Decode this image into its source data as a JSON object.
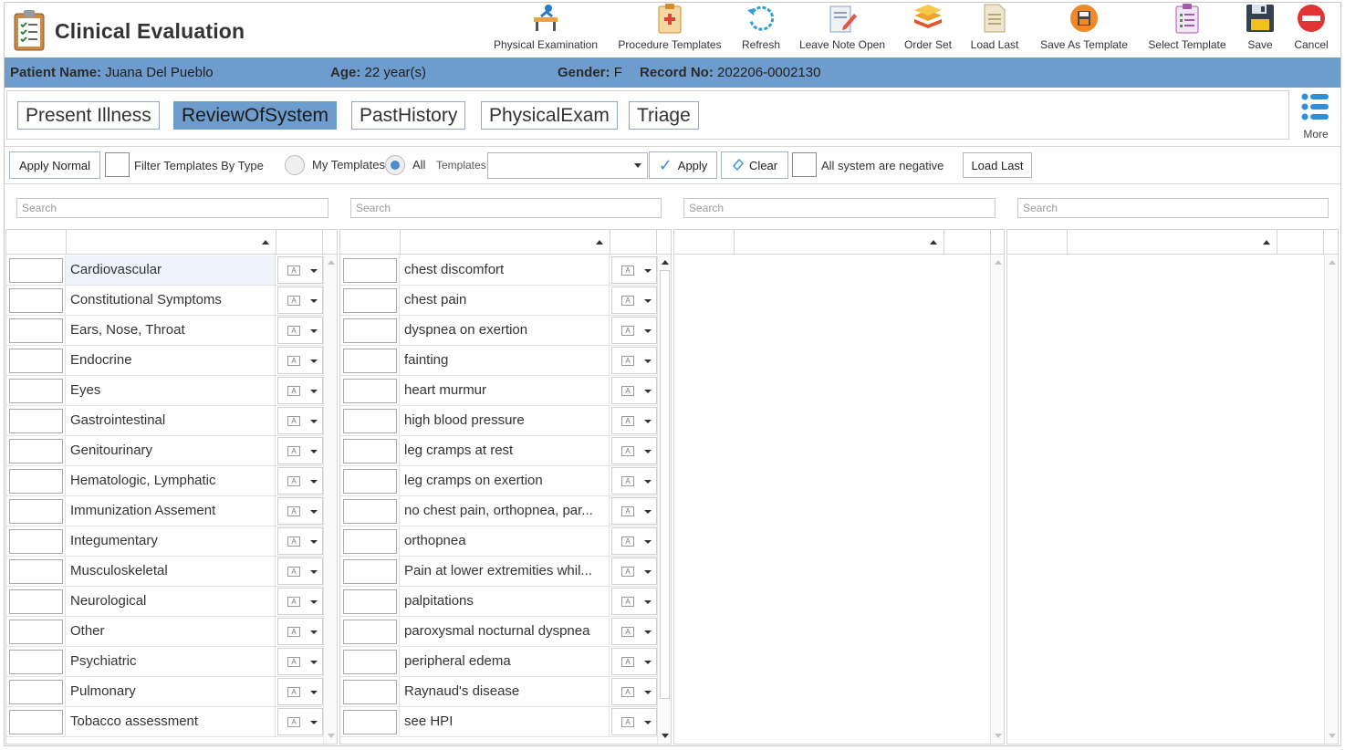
{
  "app": {
    "title": "Clinical Evaluation"
  },
  "toolbar": [
    {
      "label": "Physical Examination",
      "icon": "exam-table-icon"
    },
    {
      "label": "Procedure Templates",
      "icon": "clipboard-medical-icon"
    },
    {
      "label": "Refresh",
      "icon": "refresh-icon"
    },
    {
      "label": "Leave Note Open",
      "icon": "note-edit-icon"
    },
    {
      "label": "Order Set",
      "icon": "layers-icon"
    },
    {
      "label": "Load Last",
      "icon": "document-icon"
    },
    {
      "label": "Save As Template",
      "icon": "save-as-icon"
    },
    {
      "label": "Select Template",
      "icon": "template-list-icon"
    },
    {
      "label": "Save",
      "icon": "floppy-disk-icon"
    },
    {
      "label": "Cancel",
      "icon": "cancel-icon"
    }
  ],
  "patient": {
    "name_label": "Patient Name:",
    "name": "Juana Del Pueblo",
    "age_label": "Age:",
    "age": "22 year(s)",
    "gender_label": "Gender:",
    "gender": "F",
    "record_label": "Record No:",
    "record": "202206-0002130"
  },
  "tabs": [
    "Present Illness",
    "ReviewOfSystem",
    "PastHistory",
    "PhysicalExam",
    "Triage"
  ],
  "active_tab": "ReviewOfSystem",
  "more_label": "More",
  "filters": {
    "apply_normal": "Apply Normal",
    "filter_by_type": "Filter Templates By Type",
    "my_templates": "My Templates",
    "all": "All",
    "templates_label": "Templates:",
    "templates_value": "",
    "apply": "Apply",
    "clear": "Clear",
    "all_negative": "All system are negative",
    "load_last": "Load Last"
  },
  "search_placeholder": "Search",
  "systems": [
    "Cardiovascular",
    "Constitutional Symptoms",
    "Ears, Nose, Throat",
    "Endocrine",
    "Eyes",
    "Gastrointestinal",
    "Genitourinary",
    "Hematologic, Lymphatic",
    "Immunization Assement",
    "Integumentary",
    "Musculoskeletal",
    "Neurological",
    "Other",
    "Psychiatric",
    "Pulmonary",
    "Tobacco assessment"
  ],
  "selected_system": "Cardiovascular",
  "symptoms": [
    "chest discomfort",
    "chest pain",
    "dyspnea on exertion",
    "fainting",
    "heart murmur",
    "high blood pressure",
    "leg cramps at rest",
    "leg cramps on exertion",
    "no chest pain, orthopnea, par...",
    "orthopnea",
    "Pain at lower extremities whil...",
    "palpitations",
    "paroxysmal nocturnal dyspnea",
    "peripheral edema",
    "Raynaud's disease",
    "see HPI"
  ],
  "colors": {
    "accent": "#6e9ccc",
    "radio_on": "#4e8bd0"
  }
}
